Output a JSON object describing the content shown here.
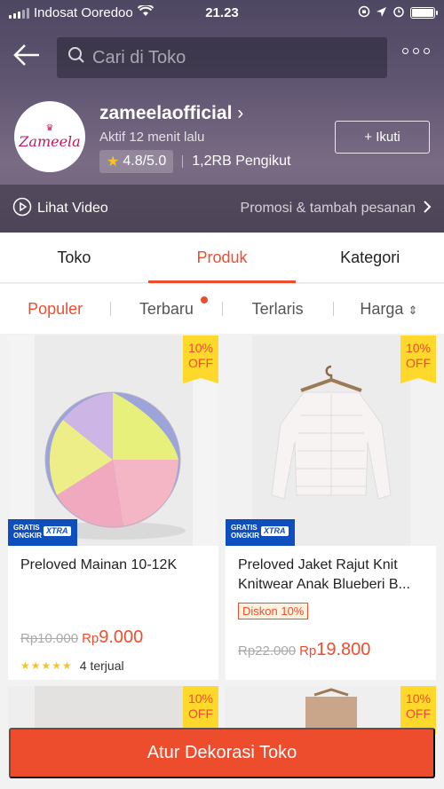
{
  "status_bar": {
    "carrier": "Indosat Ooredoo",
    "time": "21.23"
  },
  "header": {
    "search_placeholder": "Cari di Toko"
  },
  "shop": {
    "name": "zameelaofficial",
    "logo_text": "Zameela",
    "active": "Aktif 12 menit lalu",
    "rating": "4.8/5.0",
    "followers": "1,2RB Pengikut",
    "follow_label": "+ Ikuti"
  },
  "video_bar": {
    "left": "Lihat Video",
    "right": "Promosi & tambah pesanan"
  },
  "tabs": [
    "Toko",
    "Produk",
    "Kategori"
  ],
  "sort": [
    "Populer",
    "Terbaru",
    "Terlaris",
    "Harga"
  ],
  "products": [
    {
      "badge_pct": "10%",
      "badge_off": "OFF",
      "title": "Preloved Mainan 10-12K",
      "old_price": "Rp10.000",
      "currency": "Rp",
      "price": "9.000",
      "sold": "4 terjual"
    },
    {
      "badge_pct": "10%",
      "badge_off": "OFF",
      "title": "Preloved Jaket Rajut Knit Knitwear Anak Blueberi B...",
      "discount_tag": "Diskon 10%",
      "old_price": "Rp22.000",
      "currency": "Rp",
      "price": "19.800"
    },
    {
      "badge_pct": "10%",
      "badge_off": "OFF"
    },
    {
      "badge_pct": "10%",
      "badge_off": "OFF"
    }
  ],
  "gratis": {
    "line1": "GRATIS",
    "line2": "ONGKIR",
    "xtra": "XTRA"
  },
  "bottom_button": "Atur Dekorasi Toko",
  "colors": {
    "accent": "#ee4d2d",
    "badge": "#fed82a",
    "gratis_blue": "#0f4fbd"
  }
}
